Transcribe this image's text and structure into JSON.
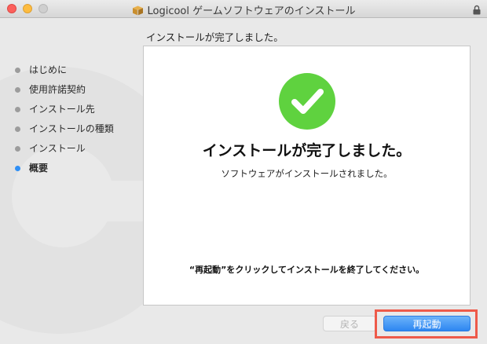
{
  "window": {
    "title": "Logicool ゲームソフトウェアのインストール",
    "icons": {
      "package": "package-icon",
      "lock": "lock-icon"
    }
  },
  "header": {
    "text": "インストールが完了しました。"
  },
  "sidebar": {
    "steps": [
      {
        "label": "はじめに",
        "active": false
      },
      {
        "label": "使用許諾契約",
        "active": false
      },
      {
        "label": "インストール先",
        "active": false
      },
      {
        "label": "インストールの種類",
        "active": false
      },
      {
        "label": "インストール",
        "active": false
      },
      {
        "label": "概要",
        "active": true
      }
    ]
  },
  "content": {
    "icon": "checkmark-icon",
    "title": "インストールが完了しました。",
    "subtitle": "ソフトウェアがインストールされました。",
    "instruction": "“再起動”をクリックしてインストールを終了してください。"
  },
  "buttons": {
    "back_label": "戻る",
    "restart_label": "再起動"
  },
  "colors": {
    "success": "#5fd23f",
    "accent": "#2d86f1",
    "highlight": "#ee5a4a"
  }
}
